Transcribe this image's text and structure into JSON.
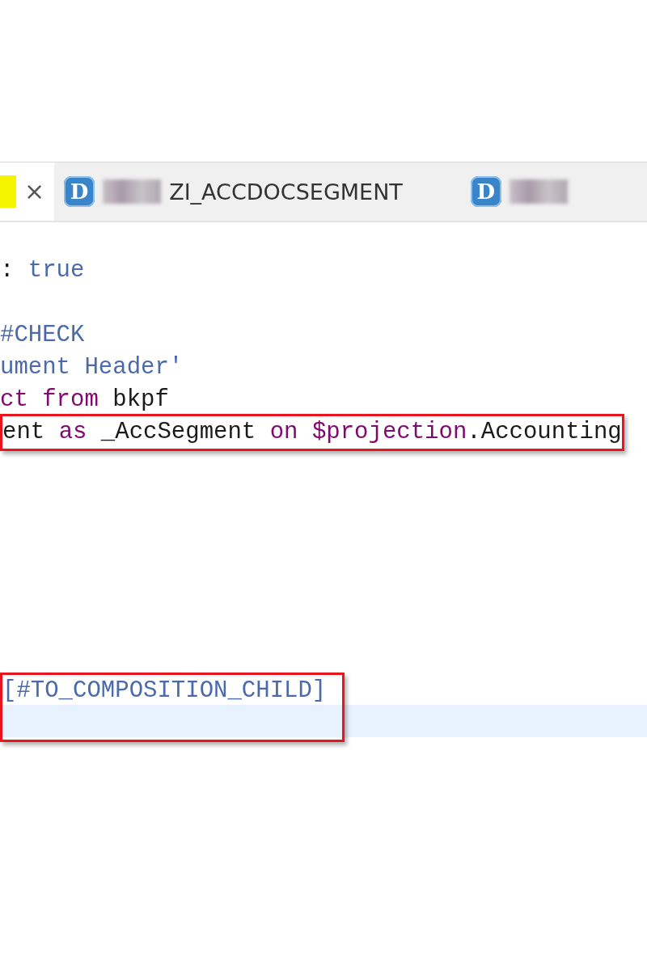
{
  "tabs": [
    {
      "selected": true,
      "marked": true,
      "close_glyph": "×"
    },
    {
      "selected": false,
      "icon_letter": "D",
      "redacted": true,
      "label": "ZI_ACCDOCSEGMENT"
    },
    {
      "selected": false,
      "icon_letter": "D",
      "redacted": true
    }
  ],
  "code_blocks": [
    {
      "boxed": false,
      "lines": [
        {
          "current": false
        },
        {
          "current": false,
          "tokens": [
            {
              "text": ": ",
              "kind": "plain"
            },
            {
              "text": "true",
              "kind": "value"
            }
          ]
        },
        {
          "current": false
        },
        {
          "current": false,
          "tokens": [
            {
              "text": "#CHECK",
              "kind": "value"
            }
          ]
        },
        {
          "current": false,
          "tokens": [
            {
              "text": "ument Header'",
              "kind": "value"
            }
          ]
        },
        {
          "current": false,
          "tokens": [
            {
              "text": "ct from",
              "kind": "keyword"
            },
            {
              "text": " bkpf",
              "kind": "plain"
            }
          ]
        }
      ]
    },
    {
      "boxed": true,
      "lines": [
        {
          "current": false,
          "tokens": [
            {
              "text": "ent ",
              "kind": "plain"
            },
            {
              "text": "as",
              "kind": "keyword"
            },
            {
              "text": " _AccSegment ",
              "kind": "plain"
            },
            {
              "text": "on $projection",
              "kind": "keyword"
            },
            {
              "text": ".Accounting",
              "kind": "plain"
            }
          ]
        }
      ]
    },
    {
      "boxed": false,
      "lines": [
        {
          "current": false
        },
        {
          "current": false
        },
        {
          "current": false
        },
        {
          "current": false
        },
        {
          "current": false
        },
        {
          "current": false
        },
        {
          "current": false
        }
      ]
    },
    {
      "boxed": true,
      "lines": [
        {
          "current": false,
          "tokens": [
            {
              "text": "[#TO_COMPOSITION_CHILD]",
              "kind": "value"
            }
          ]
        },
        {
          "current": true
        }
      ]
    }
  ]
}
